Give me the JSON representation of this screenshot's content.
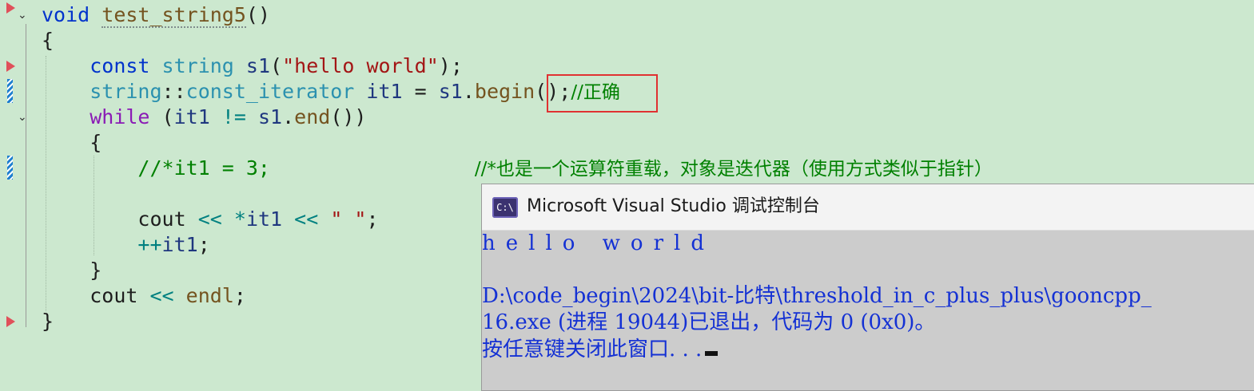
{
  "editor": {
    "lines": [
      {
        "tokens": [
          {
            "t": "void",
            "c": "kw"
          },
          {
            "t": " ",
            "c": ""
          },
          {
            "t": "test_string5",
            "c": "func squiggle"
          },
          {
            "t": "()",
            "c": ""
          }
        ]
      },
      {
        "tokens": [
          {
            "t": "{",
            "c": ""
          }
        ]
      },
      {
        "tokens": [
          {
            "t": "    ",
            "c": ""
          },
          {
            "t": "const",
            "c": "kw"
          },
          {
            "t": " ",
            "c": ""
          },
          {
            "t": "string",
            "c": "type"
          },
          {
            "t": " ",
            "c": ""
          },
          {
            "t": "s1",
            "c": "var"
          },
          {
            "t": "(",
            "c": ""
          },
          {
            "t": "\"hello world\"",
            "c": "str"
          },
          {
            "t": ");",
            "c": ""
          }
        ]
      },
      {
        "tokens": [
          {
            "t": "    ",
            "c": ""
          },
          {
            "t": "string",
            "c": "type"
          },
          {
            "t": "::",
            "c": ""
          },
          {
            "t": "const_iterator",
            "c": "type"
          },
          {
            "t": " ",
            "c": ""
          },
          {
            "t": "it1",
            "c": "var"
          },
          {
            "t": " = ",
            "c": ""
          },
          {
            "t": "s1",
            "c": "var"
          },
          {
            "t": ".",
            "c": ""
          },
          {
            "t": "begin",
            "c": "func"
          },
          {
            "t": "();",
            "c": ""
          },
          {
            "t": "//正确",
            "c": "cmt"
          }
        ]
      },
      {
        "tokens": [
          {
            "t": "    ",
            "c": ""
          },
          {
            "t": "while",
            "c": "kw-purple"
          },
          {
            "t": " (",
            "c": ""
          },
          {
            "t": "it1",
            "c": "var"
          },
          {
            "t": " ",
            "c": ""
          },
          {
            "t": "!=",
            "c": "op"
          },
          {
            "t": " ",
            "c": ""
          },
          {
            "t": "s1",
            "c": "var"
          },
          {
            "t": ".",
            "c": ""
          },
          {
            "t": "end",
            "c": "func"
          },
          {
            "t": "())",
            "c": ""
          }
        ]
      },
      {
        "tokens": [
          {
            "t": "    {",
            "c": ""
          }
        ]
      },
      {
        "tokens": [
          {
            "t": "        ",
            "c": ""
          },
          {
            "t": "//*it1 = 3;",
            "c": "cmt"
          },
          {
            "t": "                 ",
            "c": ""
          },
          {
            "t": "//*也是一个运算符重载，对象是迭代器（使用方式类似于指针）",
            "c": "cmt"
          }
        ]
      },
      {
        "tokens": [
          {
            "t": "",
            "c": ""
          }
        ]
      },
      {
        "tokens": [
          {
            "t": "        ",
            "c": ""
          },
          {
            "t": "cout",
            "c": ""
          },
          {
            "t": " ",
            "c": ""
          },
          {
            "t": "<<",
            "c": "op"
          },
          {
            "t": " ",
            "c": ""
          },
          {
            "t": "*",
            "c": "op"
          },
          {
            "t": "it1",
            "c": "var"
          },
          {
            "t": " ",
            "c": ""
          },
          {
            "t": "<<",
            "c": "op"
          },
          {
            "t": " ",
            "c": ""
          },
          {
            "t": "\" \"",
            "c": "str"
          },
          {
            "t": ";",
            "c": ""
          }
        ]
      },
      {
        "tokens": [
          {
            "t": "        ",
            "c": ""
          },
          {
            "t": "++",
            "c": "op"
          },
          {
            "t": "it1",
            "c": "var"
          },
          {
            "t": ";",
            "c": ""
          }
        ]
      },
      {
        "tokens": [
          {
            "t": "    }",
            "c": ""
          }
        ]
      },
      {
        "tokens": [
          {
            "t": "    ",
            "c": ""
          },
          {
            "t": "cout",
            "c": ""
          },
          {
            "t": " ",
            "c": ""
          },
          {
            "t": "<<",
            "c": "op"
          },
          {
            "t": " ",
            "c": ""
          },
          {
            "t": "endl",
            "c": "func"
          },
          {
            "t": ";",
            "c": ""
          }
        ]
      },
      {
        "tokens": [
          {
            "t": "}",
            "c": ""
          }
        ]
      }
    ],
    "gutter": {
      "breakpoint_arrows": [
        0,
        2,
        12
      ],
      "change_markers": [
        3,
        6
      ],
      "fold_glyphs": [
        0,
        4
      ]
    }
  },
  "console": {
    "title": "Microsoft Visual Studio 调试控制台",
    "icon_label": "C:\\",
    "icon": "console-app-icon",
    "output_line_1": "hello world",
    "output_line_2": "D:\\code_begin\\2024\\bit-比特\\threshold_in_c_plus_plus\\gooncpp_",
    "output_line_3": "16.exe (进程 19044)已退出，代码为 0 (0x0)。",
    "output_line_4": "按任意键关闭此窗口. . ."
  },
  "colors": {
    "editor_background": "#cce8cf",
    "keyword": "#0033cc",
    "control_keyword": "#8a1bb5",
    "type": "#2b91af",
    "function": "#74531f",
    "string": "#a31515",
    "comment": "#008000",
    "highlight_box": "#e03131",
    "console_text": "#1431d4",
    "console_background": "#cccccc"
  }
}
